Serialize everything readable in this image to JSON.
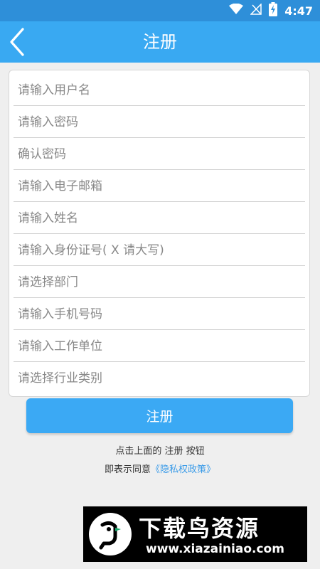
{
  "status_bar": {
    "time": "4:47",
    "icons": [
      "wifi-icon",
      "no-signal-icon",
      "battery-charging-icon"
    ]
  },
  "app_bar": {
    "back_icon": "chevron-left-icon",
    "title": "注册"
  },
  "form": {
    "fields": [
      {
        "placeholder": "请输入用户名",
        "value": ""
      },
      {
        "placeholder": "请输入密码",
        "value": ""
      },
      {
        "placeholder": "确认密码",
        "value": ""
      },
      {
        "placeholder": "请输入电子邮箱",
        "value": ""
      },
      {
        "placeholder": "请输入姓名",
        "value": ""
      },
      {
        "placeholder": "请输入身份证号( X 请大写)",
        "value": ""
      },
      {
        "placeholder": "请选择部门",
        "value": ""
      },
      {
        "placeholder": "请输入手机号码",
        "value": ""
      },
      {
        "placeholder": "请输入工作单位",
        "value": ""
      },
      {
        "placeholder": "请选择行业类别",
        "value": ""
      }
    ]
  },
  "register_button": {
    "label": "注册"
  },
  "hint": {
    "line1": "点击上面的 注册 按钮",
    "line2_prefix": "即表示同意",
    "policy_link": "《隐私权政策》"
  },
  "watermark": {
    "title": "下载鸟资源",
    "url": "www.xiazainiao.com"
  },
  "colors": {
    "status_bar": "#2e8fd9",
    "app_bar": "#39a9f2",
    "button": "#3ba9f4",
    "link": "#3a9be8"
  }
}
